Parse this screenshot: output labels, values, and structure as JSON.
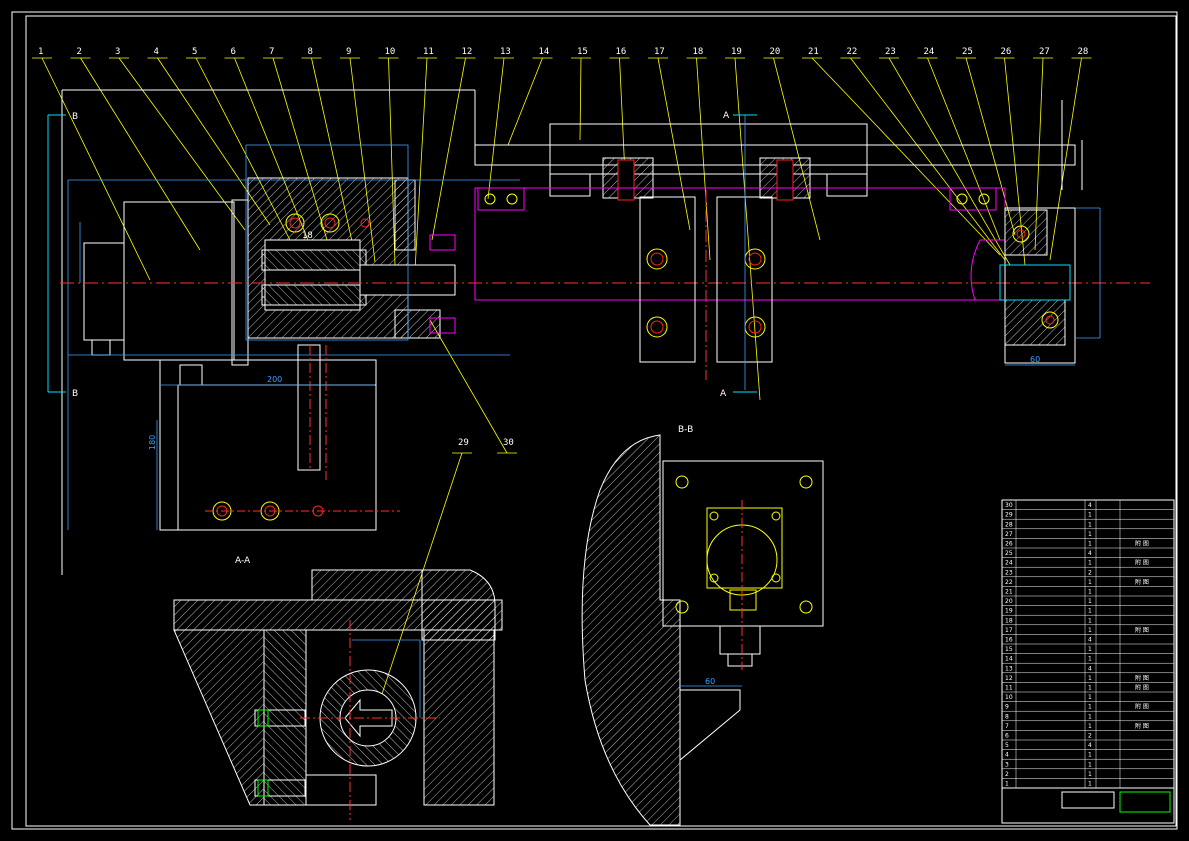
{
  "colors": {
    "background": "#000000",
    "outline": "#ffffff",
    "leader": "#ffff00",
    "center_line": "#ff3030",
    "dimension": "#3aa0ff",
    "magenta": "#ff00ff",
    "bolt": "#ff2020",
    "cyan": "#00e0ff"
  },
  "balloons": [
    "1",
    "2",
    "3",
    "4",
    "5",
    "6",
    "7",
    "8",
    "9",
    "10",
    "11",
    "12",
    "13",
    "14",
    "15",
    "16",
    "17",
    "18",
    "19",
    "20",
    "21",
    "22",
    "23",
    "24",
    "25",
    "26",
    "27",
    "28",
    "29",
    "30"
  ],
  "views": {
    "section_aa": "A-A",
    "section_bb": "B-B",
    "cut_a_top": "A",
    "cut_a_bottom": "A",
    "cut_b_top": "B",
    "cut_b_bottom": "B"
  },
  "dimensions": {
    "d_200": "200",
    "d_180": "180",
    "d_60_right": "60",
    "d_60_bb": "60",
    "d_18": "18"
  },
  "title_block": {
    "rows": [
      {
        "no": "30",
        "name": "",
        "qty": "4",
        "note": ""
      },
      {
        "no": "29",
        "name": "",
        "qty": "1",
        "note": ""
      },
      {
        "no": "28",
        "name": "",
        "qty": "1",
        "note": ""
      },
      {
        "no": "27",
        "name": "",
        "qty": "1",
        "note": ""
      },
      {
        "no": "26",
        "name": "",
        "qty": "1",
        "note": "附 图"
      },
      {
        "no": "25",
        "name": "",
        "qty": "4",
        "note": ""
      },
      {
        "no": "24",
        "name": "",
        "qty": "1",
        "note": "附 图"
      },
      {
        "no": "23",
        "name": "",
        "qty": "2",
        "note": ""
      },
      {
        "no": "22",
        "name": "",
        "qty": "1",
        "note": "附 图"
      },
      {
        "no": "21",
        "name": "",
        "qty": "1",
        "note": ""
      },
      {
        "no": "20",
        "name": "",
        "qty": "1",
        "note": ""
      },
      {
        "no": "19",
        "name": "",
        "qty": "1",
        "note": ""
      },
      {
        "no": "18",
        "name": "",
        "qty": "1",
        "note": ""
      },
      {
        "no": "17",
        "name": "",
        "qty": "1",
        "note": "附 图"
      },
      {
        "no": "16",
        "name": "",
        "qty": "4",
        "note": ""
      },
      {
        "no": "15",
        "name": "",
        "qty": "1",
        "note": ""
      },
      {
        "no": "14",
        "name": "",
        "qty": "1",
        "note": ""
      },
      {
        "no": "13",
        "name": "",
        "qty": "4",
        "note": ""
      },
      {
        "no": "12",
        "name": "",
        "qty": "1",
        "note": "附 图"
      },
      {
        "no": "11",
        "name": "",
        "qty": "1",
        "note": "附 图"
      },
      {
        "no": "10",
        "name": "",
        "qty": "1",
        "note": ""
      },
      {
        "no": "9",
        "name": "",
        "qty": "1",
        "note": "附 图"
      },
      {
        "no": "8",
        "name": "",
        "qty": "1",
        "note": ""
      },
      {
        "no": "7",
        "name": "",
        "qty": "1",
        "note": "附 图"
      },
      {
        "no": "6",
        "name": "",
        "qty": "2",
        "note": ""
      },
      {
        "no": "5",
        "name": "",
        "qty": "4",
        "note": ""
      },
      {
        "no": "4",
        "name": "",
        "qty": "1",
        "note": ""
      },
      {
        "no": "3",
        "name": "",
        "qty": "1",
        "note": ""
      },
      {
        "no": "2",
        "name": "",
        "qty": "1",
        "note": ""
      },
      {
        "no": "1",
        "name": "",
        "qty": "1",
        "note": ""
      }
    ]
  }
}
